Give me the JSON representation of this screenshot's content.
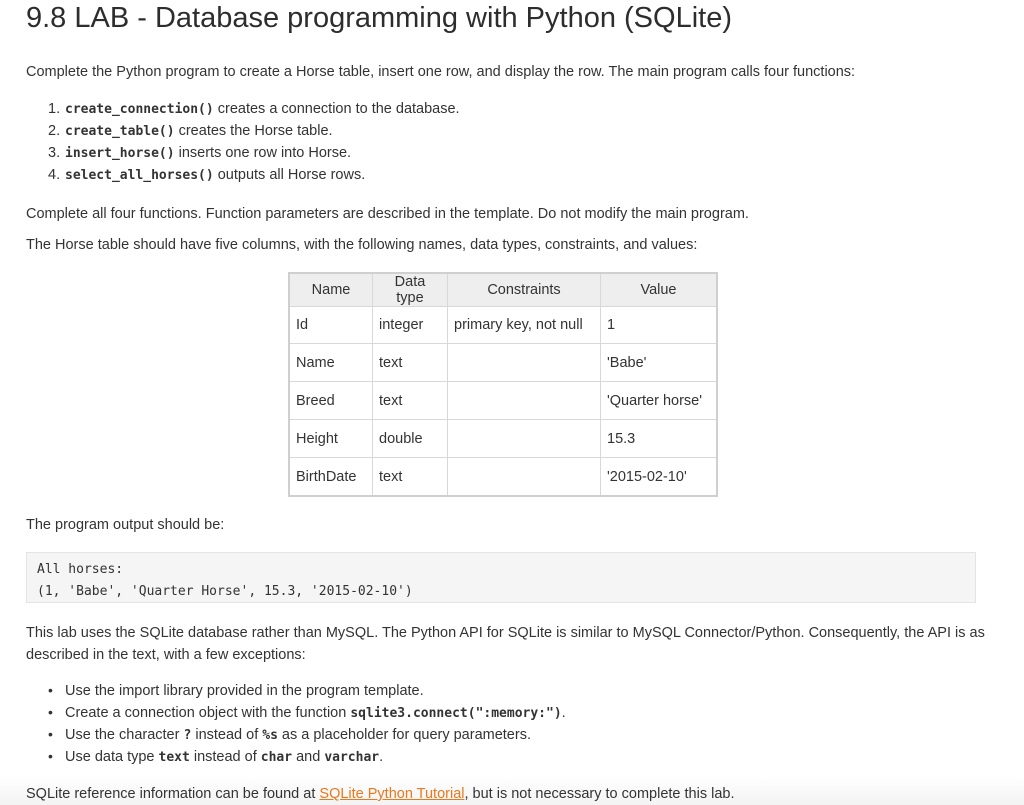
{
  "title": "9.8 LAB - Database programming with Python (SQLite)",
  "intro": "Complete the Python program to create a Horse table, insert one row, and display the row. The main program calls four functions:",
  "steps": [
    {
      "num": "1.",
      "code": "create_connection()",
      "desc": " creates a connection to the database."
    },
    {
      "num": "2.",
      "code": "create_table()",
      "desc": " creates the Horse table."
    },
    {
      "num": "3.",
      "code": "insert_horse()",
      "desc": " inserts one row into Horse."
    },
    {
      "num": "4.",
      "code": "select_all_horses()",
      "desc": " outputs all Horse rows."
    }
  ],
  "complete_text": "Complete all four functions. Function parameters are described in the template. Do not modify the main program.",
  "horse_text": "The Horse table should have five columns, with the following names, data types, constraints, and values:",
  "table": {
    "headers": [
      "Name",
      "Data type",
      "Constraints",
      "Value"
    ],
    "rows": [
      [
        "Id",
        "integer",
        "primary key, not null",
        "1"
      ],
      [
        "Name",
        "text",
        "",
        "'Babe'"
      ],
      [
        "Breed",
        "text",
        "",
        "'Quarter horse'"
      ],
      [
        "Height",
        "double",
        "",
        "15.3"
      ],
      [
        "BirthDate",
        "text",
        "",
        "'2015-02-10'"
      ]
    ]
  },
  "output_label": "The program output should be:",
  "output_lines": [
    "All horses:",
    "(1, 'Babe', 'Quarter Horse', 15.3, '2015-02-10')"
  ],
  "lab_text": "This lab uses the SQLite database rather than MySQL. The Python API for SQLite is similar to MySQL Connector/Python. Consequently, the API is as described in the text, with a few exceptions:",
  "bullets": {
    "b1": "Use the import library provided in the program template.",
    "b2_pre": "Create a connection object with the function ",
    "b2_code": "sqlite3.connect(\":memory:\")",
    "b2_post": ".",
    "b3_pre": "Use the character ",
    "b3_code1": "?",
    "b3_mid": " instead of ",
    "b3_code2": "%s",
    "b3_post": " as a placeholder for query parameters.",
    "b4_pre": "Use data type ",
    "b4_code1": "text",
    "b4_mid1": " instead of ",
    "b4_code2": "char",
    "b4_mid2": " and ",
    "b4_code3": "varchar",
    "b4_post": "."
  },
  "reference": {
    "pre": "SQLite reference information can be found at ",
    "link": "SQLite Python Tutorial",
    "post": ", but is not necessary to complete this lab."
  },
  "colors": {
    "link": "#e8791d",
    "code_bg": "#f5f5f5",
    "header_bg": "#eeeeee"
  }
}
